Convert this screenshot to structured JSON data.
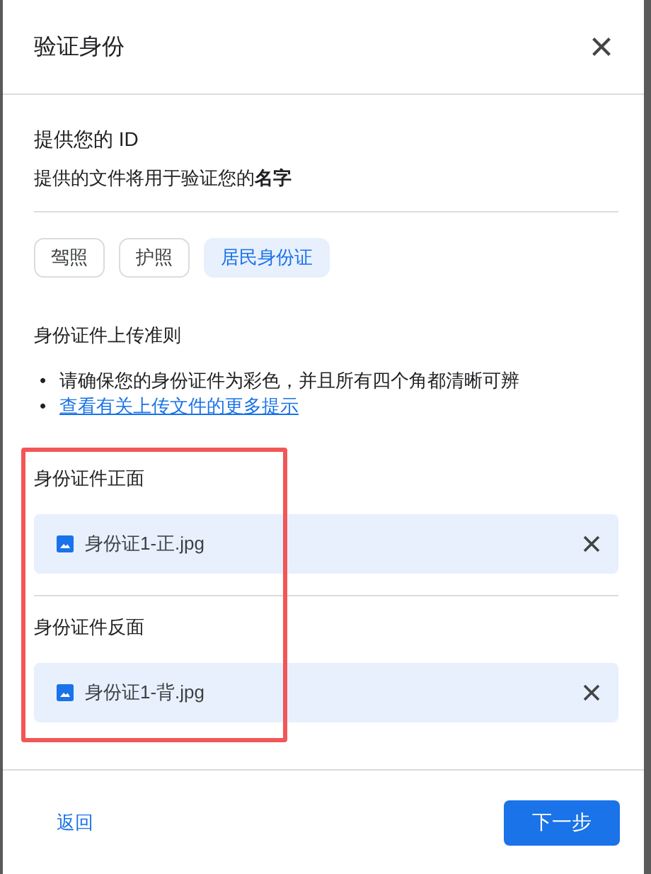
{
  "dialog": {
    "title": "验证身份"
  },
  "heading": "提供您的 ID",
  "subtitle": "提供的文件将用于验证您的**名字**",
  "id_types": [
    {
      "label": "驾照",
      "selected": false
    },
    {
      "label": "护照",
      "selected": false
    },
    {
      "label": "居民身份证",
      "selected": true
    }
  ],
  "guidelines": {
    "title": "身份证件上传准则",
    "items": [
      {
        "kind": "text",
        "bullet": "•",
        "text": "请确保您的身份证件为彩色，并且所有四个角都清晰可辨"
      },
      {
        "kind": "link",
        "bullet": "•",
        "text": "查看有关上传文件的更多提示"
      }
    ]
  },
  "uploads": [
    {
      "label": "身份证件正面",
      "file": "身份证1-正.jpg"
    },
    {
      "label": "身份证件反面",
      "file": "身份证1-背.jpg"
    }
  ],
  "footer": {
    "back": "返回",
    "next": "下一步"
  }
}
